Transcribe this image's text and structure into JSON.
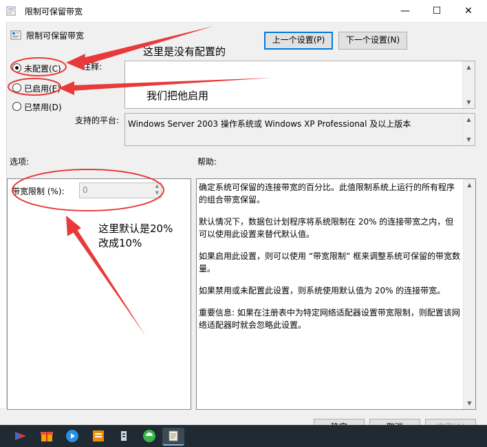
{
  "window": {
    "title": "限制可保留带宽",
    "minimize_glyph": "—",
    "maximize_glyph": "☐",
    "close_glyph": "✕"
  },
  "header": {
    "title": "限制可保留带宽",
    "prev_button": "上一个设置(P)",
    "next_button": "下一个设置(N)"
  },
  "radios": {
    "not_configured": "未配置(C)",
    "enabled": "已启用(E)",
    "disabled": "已禁用(D)",
    "selected": "not_configured"
  },
  "comment": {
    "label": "注释:",
    "value": ""
  },
  "platform": {
    "label": "支持的平台:",
    "value": "Windows Server 2003 操作系统或 Windows XP Professional 及以上版本"
  },
  "options": {
    "heading": "选项:",
    "bandwidth_label": "带宽限制 (%):",
    "bandwidth_value": "0"
  },
  "help": {
    "heading": "帮助:",
    "paragraphs": [
      "确定系统可保留的连接带宽的百分比。此值限制系统上运行的所有程序的组合带宽保留。",
      "默认情况下，数据包计划程序将系统限制在 20% 的连接带宽之内，但可以使用此设置来替代默认值。",
      "如果启用此设置，则可以使用 “带宽限制” 框来调整系统可保留的带宽数量。",
      "如果禁用或未配置此设置，则系统使用默认值为 20% 的连接带宽。",
      "重要信息: 如果在注册表中为特定网络适配器设置带宽限制，则配置该网络适配器时就会忽略此设置。"
    ]
  },
  "footer": {
    "ok": "确定",
    "cancel": "取消",
    "apply": "应用(A)"
  },
  "annotations": {
    "note1": "这里是没有配置的",
    "note2": "我们把他启用",
    "note3_line1": "这里默认是20%",
    "note3_line2": "改成10%"
  },
  "colors": {
    "annotation_red": "#e83a3a",
    "taskbar": "#1f2a33"
  }
}
